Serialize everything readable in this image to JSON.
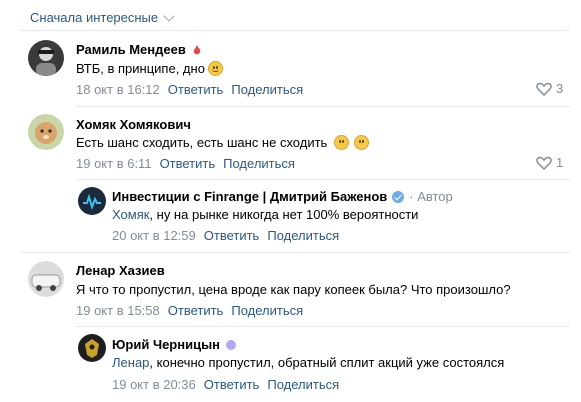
{
  "sort": {
    "label": "Сначала интересные"
  },
  "comments": [
    {
      "name": "Рамиль Мендеев",
      "text": "ВТБ, в принципе, дно",
      "date": "18 окт в 16:12",
      "reply": "Ответить",
      "share": "Поделиться",
      "likes": "3"
    },
    {
      "name": "Хомяк Хомякович",
      "text": "Есть шанс сходить, есть шанс не сходить",
      "date": "19 окт в 6:11",
      "reply": "Ответить",
      "share": "Поделиться",
      "likes": "1"
    },
    {
      "name": "Инвестиции с Finrange | Дмитрий Баженов",
      "author_tag": "· Автор",
      "reply_to": "Хомяк",
      "text": ", ну на рынке никогда нет 100% вероятности",
      "date": "20 окт в 12:59",
      "reply": "Ответить",
      "share": "Поделиться"
    },
    {
      "name": "Ленар Хазиев",
      "text": "Я что то пропустил, цена вроде как пару копеек была? Что произошло?",
      "date": "19 окт в 15:58",
      "reply": "Ответить",
      "share": "Поделиться"
    },
    {
      "name": "Юрий Черницын",
      "reply_to": "Ленар",
      "text": ", конечно пропустил, обратный сплит акций уже состоялся",
      "date": "19 окт в 20:36",
      "reply": "Ответить",
      "share": "Поделиться"
    }
  ],
  "colors": {
    "link": "#2a5885",
    "meta": "#818c99",
    "separator": "#e7e8ec"
  }
}
